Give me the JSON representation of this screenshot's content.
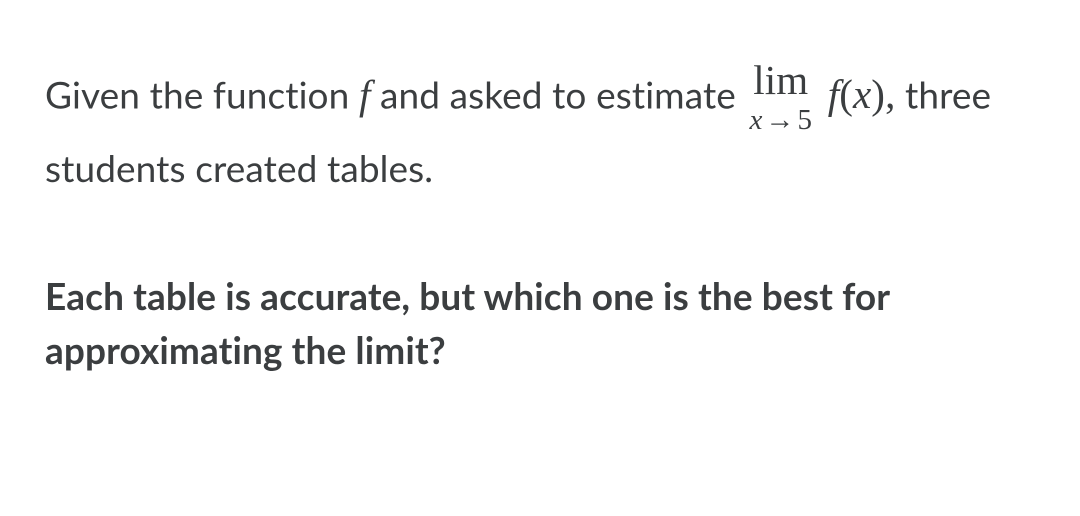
{
  "para1": {
    "t1": "Given the function ",
    "f": "f",
    "t2": "  and asked to estimate ",
    "lim": "lim",
    "lim_sub_x": "x",
    "lim_sub_arrow": "→",
    "lim_sub_val": "5",
    "fx_f": "f",
    "fx_open": "(",
    "fx_x": "x",
    "fx_close": ")",
    "comma": ",",
    "t3": " three students created tables."
  },
  "para2": {
    "text": "Each table is accurate, but which one is the best for approximating the limit?"
  }
}
